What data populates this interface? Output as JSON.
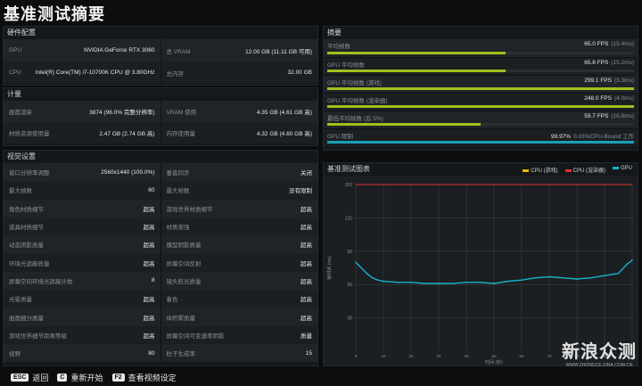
{
  "title": "基准测试摘要",
  "hardware": {
    "header": "硬件配置",
    "rows": [
      [
        {
          "label": "GPU",
          "value": "NVIDIA GeForce RTX 3060"
        },
        {
          "label": "总 VRAM",
          "value": "12.00 GB (11.11 GB 可用)"
        }
      ],
      [
        {
          "label": "CPU",
          "value": "Intel(R) Core(TM) i7-10700K CPU @ 3.80GHz"
        },
        {
          "label": "总内存",
          "value": "32.00 GB"
        }
      ]
    ]
  },
  "memory": {
    "header": "计量",
    "rows": [
      [
        {
          "label": "画面渲染",
          "value": "3874 (96.0% 完整分辨率)"
        },
        {
          "label": "VRAM 使用",
          "value": "4.35 GB (4.61 GB 高)"
        }
      ],
      [
        {
          "label": "材质资源使用量",
          "value": "2.47 GB (2.74 GB 高)"
        },
        {
          "label": "内存使用量",
          "value": "4.32 GB (4.60 GB 高)"
        }
      ]
    ]
  },
  "video": {
    "header": "视觉设置",
    "rows": [
      [
        {
          "label": "窗口分辨率调整",
          "value": "2560x1440 (100.0%)"
        },
        {
          "label": "垂直同步",
          "value": "关闭"
        }
      ],
      [
        {
          "label": "最大帧数",
          "value": "60"
        },
        {
          "label": "最大帧数",
          "value": "没有限制"
        }
      ],
      [
        {
          "label": "角色材质细节",
          "value": "超高"
        },
        {
          "label": "游戏世界材质细节",
          "value": "超高"
        }
      ],
      [
        {
          "label": "道具材质细节",
          "value": "超高"
        },
        {
          "label": "材质渐强",
          "value": "超高"
        }
      ],
      [
        {
          "label": "动态阴影质量",
          "value": "超高"
        },
        {
          "label": "模型阴影质量",
          "value": "超高"
        }
      ],
      [
        {
          "label": "环境光遮蔽质量",
          "value": "超高"
        },
        {
          "label": "屏幕空间反射",
          "value": "超高"
        }
      ],
      [
        {
          "label": "屏幕空间环境光遮蔽计数",
          "value": "8"
        },
        {
          "label": "镜头航光质量",
          "value": "超高"
        }
      ],
      [
        {
          "label": "光晕质量",
          "value": "超高"
        },
        {
          "label": "着色",
          "value": "超高"
        }
      ],
      [
        {
          "label": "曲面细分质量",
          "value": "超高"
        },
        {
          "label": "体积雾质量",
          "value": "超高"
        }
      ],
      [
        {
          "label": "游戏世界细节距离等级",
          "value": "超高"
        },
        {
          "label": "屏幕空间可变速率阴影",
          "value": "质量"
        }
      ],
      [
        {
          "label": "视野",
          "value": "80"
        },
        {
          "label": "粒子生成率",
          "value": "15"
        }
      ]
    ]
  },
  "summary": {
    "header": "摘要",
    "rows": [
      {
        "label": "平均帧数",
        "value": "65.0 FPS",
        "extra": "(15.4ms)",
        "fill": 0.58,
        "color": "#9ec21c"
      },
      {
        "label": "GPU 平均帧数",
        "value": "65.8 FPS",
        "extra": "(15.2ms)",
        "fill": 0.58,
        "color": "#9ec21c"
      },
      {
        "label": "GPU 平均帧数 (游戏)",
        "value": "299.1 FPS",
        "extra": "(3.3ms)",
        "fill": 1.0,
        "color": "#9ec21c"
      },
      {
        "label": "GPU 平均帧数 (渲染器)",
        "value": "248.0 FPS",
        "extra": "(4.0ms)",
        "fill": 1.0,
        "color": "#9ec21c"
      },
      {
        "label": "最低平均帧数 (后 5%)",
        "value": "59.7 FPS",
        "extra": "(16.8ms)",
        "fill": 0.5,
        "color": "#9ec21c"
      },
      {
        "label": "GPU 限制",
        "value": "99.97%",
        "extra": "0.03%CPU-Bound 工作",
        "fill": 1.0,
        "color": "#1aa0b8"
      }
    ]
  },
  "graph": {
    "header": "基准测试图表",
    "legend": [
      {
        "label": "CPU (游戏)",
        "color": "#e6b800"
      },
      {
        "label": "CPU (渲染器)",
        "color": "#e03030"
      },
      {
        "label": "GPU",
        "color": "#1ab0c8"
      }
    ]
  },
  "chart_data": {
    "type": "line",
    "title": "基准测试图表",
    "xlabel": "时间 (秒)",
    "ylabel": "帧时间 (ms)",
    "xlim": [
      0,
      100
    ],
    "ylim": [
      0,
      150
    ],
    "x_ticks": [
      "0",
      "10",
      "20",
      "30",
      "40",
      "50",
      "60",
      "70",
      "80",
      "90",
      "100"
    ],
    "y_ticks": [
      "30",
      "60",
      "90",
      "120",
      "150"
    ],
    "reference_line": 150,
    "series": [
      {
        "name": "GPU",
        "color": "#1ab0c8",
        "x": [
          0,
          2,
          4,
          6,
          8,
          10,
          15,
          20,
          25,
          30,
          35,
          40,
          45,
          50,
          55,
          60,
          65,
          70,
          75,
          80,
          85,
          90,
          95,
          98,
          100
        ],
        "y": [
          80,
          75,
          70,
          66,
          64,
          63,
          62,
          62,
          61,
          61,
          61,
          62,
          62,
          61,
          63,
          64,
          66,
          67,
          66,
          65,
          66,
          68,
          70,
          78,
          82
        ]
      }
    ]
  },
  "bottom": {
    "items": [
      {
        "key": "ESC",
        "label": "返回"
      },
      {
        "key": "C",
        "label": "重新开始"
      },
      {
        "key": "F2",
        "label": "查看视频设定"
      }
    ]
  },
  "watermark": {
    "big": "新浪众测",
    "small": "WWW.ZHONGCE.SINA.COM.CN"
  }
}
